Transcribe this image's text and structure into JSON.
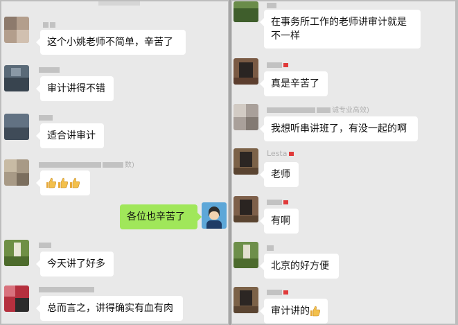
{
  "left_messages": [
    {
      "text": "这个小姚老师不简单，辛苦了"
    },
    {
      "text": "审计讲得不错"
    },
    {
      "text": "适合讲审计"
    },
    {
      "name_suffix": "数)"
    },
    {
      "text": "各位也辛苦了"
    },
    {
      "text": "今天讲了好多"
    },
    {
      "text": "总而言之，讲得确实有血有肉"
    }
  ],
  "right_messages": [
    {
      "text": "在事务所工作的老师讲审计就是不一样"
    },
    {
      "text": "真是辛苦了"
    },
    {
      "name": "诚专业高效)",
      "text": "我想听串讲班了，有没一起的啊"
    },
    {
      "name": "Lesta",
      "text": "老师"
    },
    {
      "text": "有啊"
    },
    {
      "text": "北京的好方便"
    },
    {
      "text": "审计讲的"
    }
  ],
  "icons": {
    "thumbs_up": "thumbs-up-icon"
  },
  "colors": {
    "bubble_self": "#a0e75a",
    "bubble_other": "#ffffff",
    "background": "#e9e9e9"
  }
}
